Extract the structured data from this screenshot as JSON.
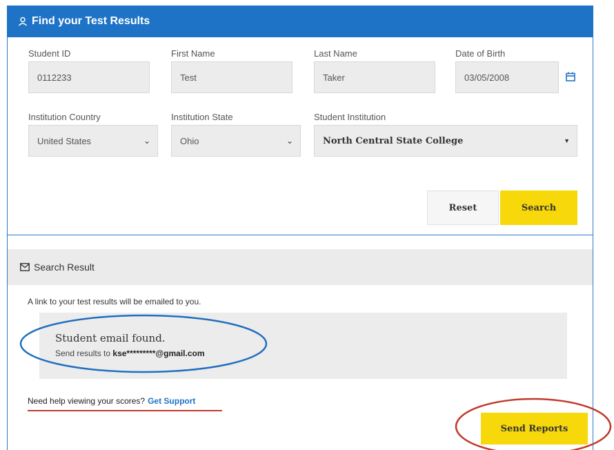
{
  "header": {
    "title": "Find your Test Results",
    "icon": "user-icon"
  },
  "form": {
    "student_id": {
      "label": "Student ID",
      "value": "0112233"
    },
    "first_name": {
      "label": "First Name",
      "value": "Test"
    },
    "last_name": {
      "label": "Last Name",
      "value": "Taker"
    },
    "dob": {
      "label": "Date of Birth",
      "value": "03/05/2008",
      "icon": "calendar-icon"
    },
    "country": {
      "label": "Institution Country",
      "value": "United States"
    },
    "state": {
      "label": "Institution State",
      "value": "Ohio"
    },
    "institution": {
      "label": "Student Institution",
      "value": "North Central State College"
    }
  },
  "buttons": {
    "reset": "Reset",
    "search": "Search",
    "send_reports": "Send Reports"
  },
  "result": {
    "header": "Search Result",
    "icon": "mail-icon",
    "message": "A link to your test results will be emailed to you.",
    "found_title": "Student email found.",
    "send_prefix": "Send results to",
    "email": "kse*********@gmail.com"
  },
  "help": {
    "text": "Need help viewing your scores?",
    "link": "Get Support"
  },
  "colors": {
    "header_blue": "#1f73c6",
    "button_yellow": "#f7d80a",
    "annotation_red": "#c0392b",
    "annotation_blue": "#1f6fbf"
  }
}
